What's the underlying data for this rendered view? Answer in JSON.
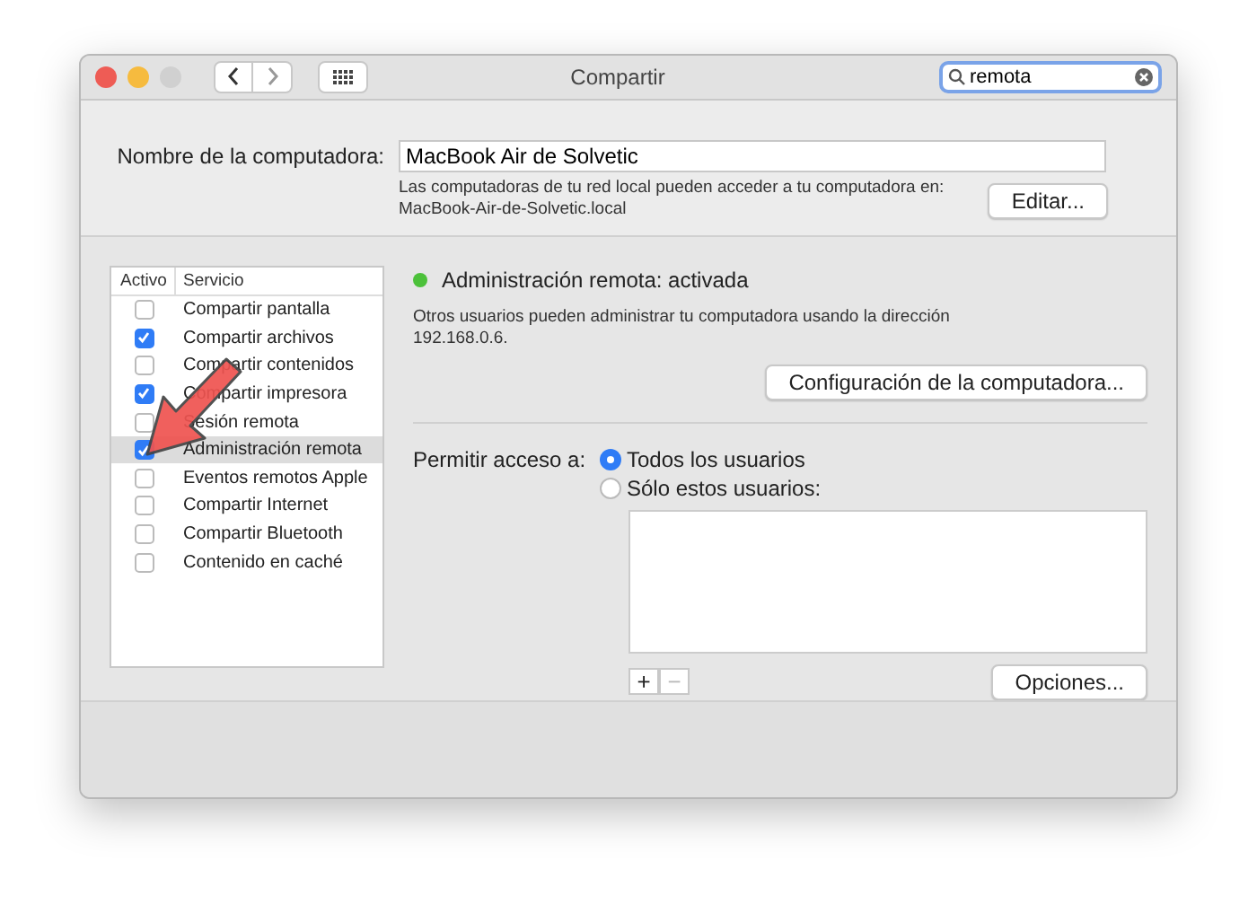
{
  "window": {
    "title": "Compartir"
  },
  "search": {
    "value": "remota"
  },
  "computer_name": {
    "label": "Nombre de la computadora:",
    "value": "MacBook Air de Solvetic",
    "info": "Las computadoras de tu red local pueden acceder a tu computadora en:",
    "address": "MacBook-Air-de-Solvetic.local",
    "button": "Editar..."
  },
  "services": {
    "columns": [
      "Activo",
      "Servicio"
    ],
    "items": [
      {
        "name": "Compartir pantalla",
        "checked": false,
        "selected": false
      },
      {
        "name": "Compartir archivos",
        "checked": true,
        "selected": false
      },
      {
        "name": "Compartir contenidos",
        "checked": false,
        "selected": false
      },
      {
        "name": "Compartir impresora",
        "checked": true,
        "selected": false
      },
      {
        "name": "Sesión remota",
        "checked": false,
        "selected": false
      },
      {
        "name": "Administración remota",
        "checked": true,
        "selected": true
      },
      {
        "name": "Eventos remotos Apple",
        "checked": false,
        "selected": false
      },
      {
        "name": "Compartir Internet",
        "checked": false,
        "selected": false
      },
      {
        "name": "Compartir Bluetooth",
        "checked": false,
        "selected": false
      },
      {
        "name": "Contenido en caché",
        "checked": false,
        "selected": false
      }
    ]
  },
  "status": {
    "text": "Administración remota: activada",
    "color": "#4cc13a",
    "description": "Otros usuarios pueden administrar tu computadora usando la dirección 192.168.0.6.",
    "button": "Configuración de la computadora..."
  },
  "access": {
    "label": "Permitir acceso a:",
    "options": [
      {
        "label": "Todos los usuarios",
        "selected": true
      },
      {
        "label": "Sólo estos usuarios:",
        "selected": false
      }
    ],
    "list_buttons": [
      {
        "label": "+",
        "disabled": false
      },
      {
        "label": "−",
        "disabled": true
      }
    ],
    "options_button": "Opciones..."
  }
}
